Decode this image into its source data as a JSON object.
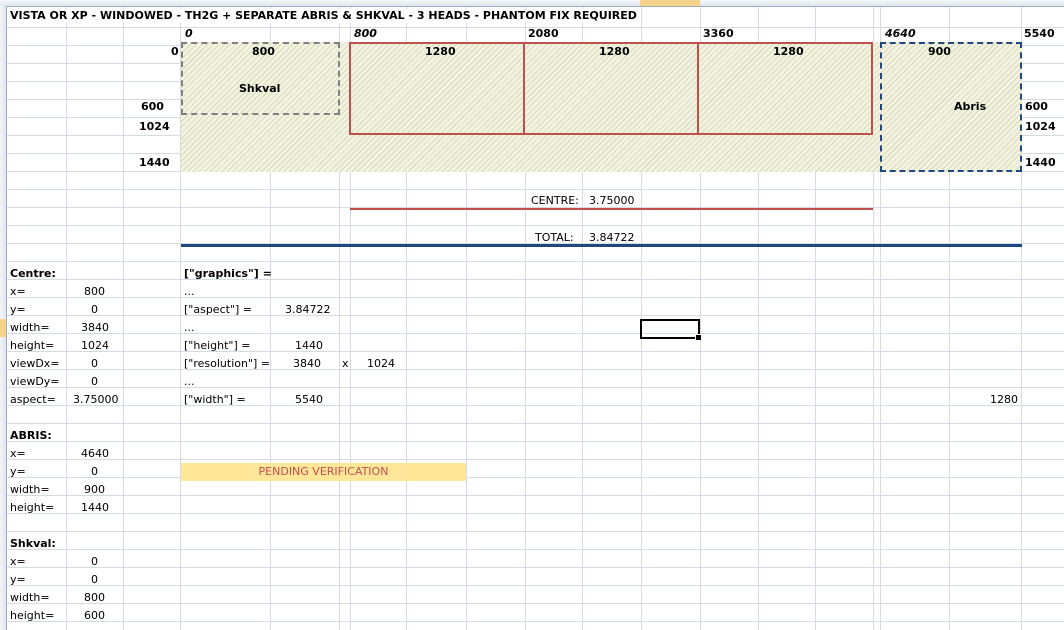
{
  "title": "VISTA OR XP - WINDOWED - TH2G + SEPARATE ABRIS & SHKVAL - 3 HEADS - PHANTOM FIX REQUIRED",
  "positions": [
    "0",
    "800",
    "2080",
    "3360",
    "4640",
    "5540"
  ],
  "widths": [
    "800",
    "1280",
    "1280",
    "1280",
    "900"
  ],
  "heights_left": [
    "600",
    "1024",
    "1440"
  ],
  "heights_right": [
    "600",
    "1024",
    "1440"
  ],
  "zero_mark": "0",
  "shkval_label": "Shkval",
  "abris_label": "Abris",
  "centre_calc": {
    "label": "CENTRE:",
    "value": "3.75000"
  },
  "total_calc": {
    "label": "TOTAL:",
    "value": "3.84722"
  },
  "centre": {
    "header": "Centre:",
    "rows": [
      {
        "label": "x=",
        "value": "800"
      },
      {
        "label": "y=",
        "value": "0"
      },
      {
        "label": "width=",
        "value": "3840"
      },
      {
        "label": "height=",
        "value": "1024"
      },
      {
        "label": "viewDx=",
        "value": "0"
      },
      {
        "label": "viewDy=",
        "value": "0"
      },
      {
        "label": "aspect=",
        "value": "3.75000"
      }
    ]
  },
  "abris": {
    "header": "ABRIS:",
    "rows": [
      {
        "label": "x=",
        "value": "4640"
      },
      {
        "label": "y=",
        "value": "0"
      },
      {
        "label": "width=",
        "value": "900"
      },
      {
        "label": "height=",
        "value": "1440"
      }
    ]
  },
  "shkval": {
    "header": "Shkval:",
    "rows": [
      {
        "label": "x=",
        "value": "0"
      },
      {
        "label": "y=",
        "value": "0"
      },
      {
        "label": "width=",
        "value": "800"
      },
      {
        "label": "height=",
        "value": "600"
      }
    ]
  },
  "graphics": {
    "header": "[\"graphics\"] =",
    "ellipsis": "...",
    "aspect_label": "[\"aspect\"] =",
    "aspect_value": "3.84722",
    "height_label": "[\"height\"] =",
    "height_value": "1440",
    "resolution_label": "[\"resolution\"] =",
    "resolution_w": "3840",
    "resolution_x": "x",
    "resolution_h": "1024",
    "width_label": "[\"width\"] =",
    "width_value": "5540"
  },
  "stray_value": "1280",
  "pending": "PENDING VERIFICATION",
  "colors": {
    "red_border": "#c0504d",
    "blue_border": "#1f497d",
    "grey_dash": "#808080",
    "pending_fill": "#ffe699",
    "pending_text": "#c0504d",
    "total_line": "#1f497d",
    "centre_line": "#c0504d"
  }
}
